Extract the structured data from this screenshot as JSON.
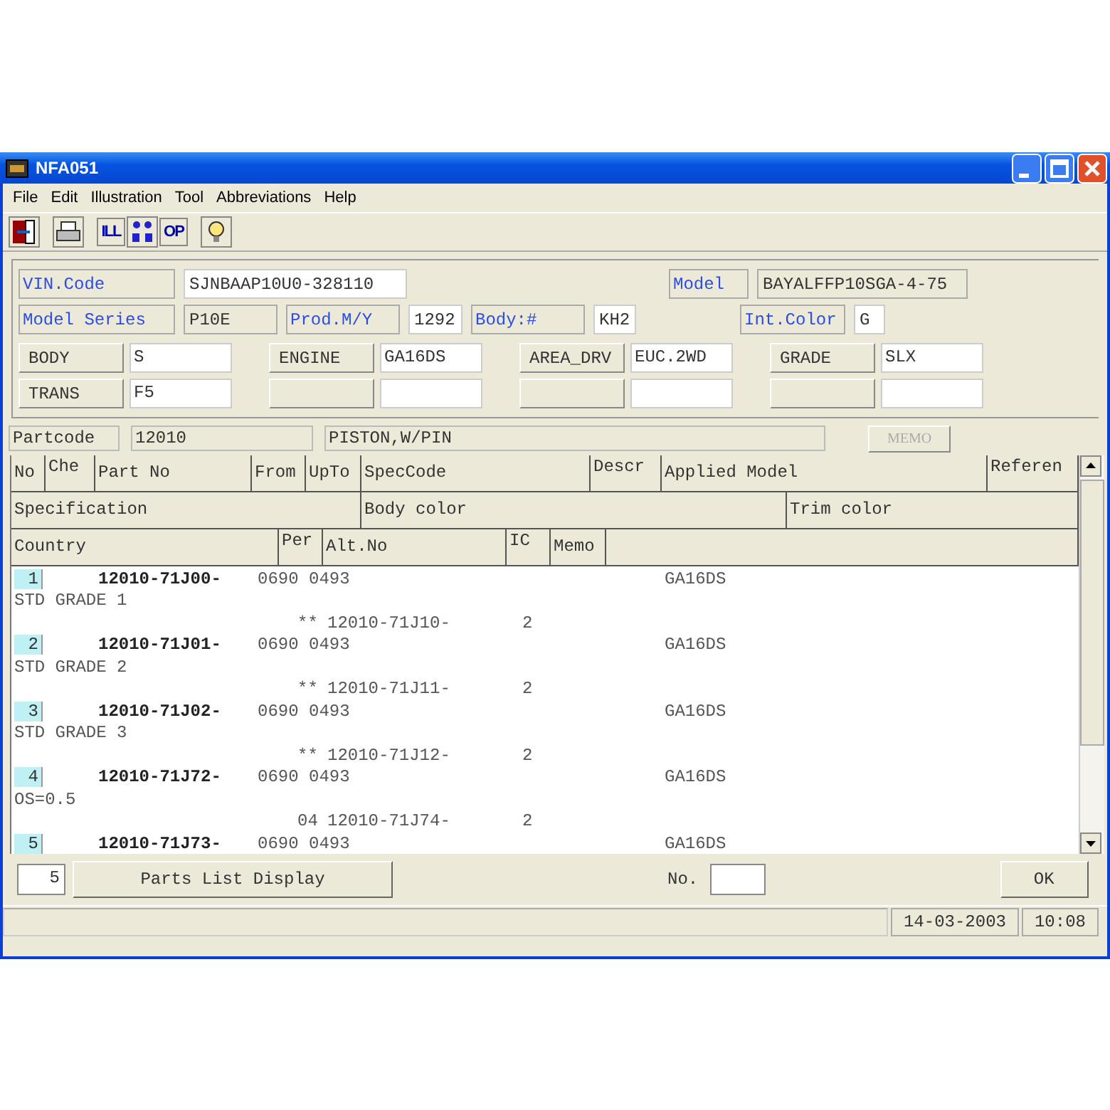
{
  "window": {
    "title": "NFA051"
  },
  "menu": [
    "File",
    "Edit",
    "Illustration",
    "Tool",
    "Abbreviations",
    "Help"
  ],
  "toolbar": [
    {
      "kind": "exit"
    },
    {
      "kind": "print"
    },
    {
      "kind": "text",
      "label": "ILL"
    },
    {
      "kind": "tree"
    },
    {
      "kind": "text",
      "label": "OP"
    },
    {
      "kind": "bulb"
    }
  ],
  "vehicle": {
    "vin_code": {
      "label": "VIN.Code",
      "value": "SJNBAAP10U0-328110"
    },
    "model": {
      "label": "Model",
      "value": "BAYALFFP10SGA-4-75"
    },
    "model_series": {
      "label": "Model Series",
      "value": "P10E"
    },
    "prod_my": {
      "label": "Prod.M/Y",
      "value": "1292"
    },
    "body_no": {
      "label": "Body:#",
      "value": "KH2"
    },
    "int_color": {
      "label": "Int.Color",
      "value": "G"
    }
  },
  "spec_options": [
    {
      "label": "BODY",
      "value": "S"
    },
    {
      "label": "ENGINE",
      "value": "GA16DS"
    },
    {
      "label": "AREA_DRV",
      "value": "EUC.2WD"
    },
    {
      "label": "GRADE",
      "value": "SLX"
    },
    {
      "label": "TRANS",
      "value": "F5"
    }
  ],
  "partcode": {
    "label": "Partcode",
    "value": "12010",
    "description": "PISTON,W/PIN",
    "memo_button": "MEMO"
  },
  "table": {
    "header_row_1": [
      "No",
      "Che",
      "Part No",
      "From",
      "UpTo",
      "SpecCode",
      "Descr",
      "Applied Model",
      "Referen"
    ],
    "header_row_2": [
      "Specification",
      "Body color",
      "Trim color"
    ],
    "header_row_3": [
      "Country",
      "Per",
      "Alt.No",
      "IC",
      "Memo"
    ],
    "rows": [
      {
        "no": "1",
        "part_no": "12010-71J00-",
        "from": "0690",
        "upto": "0493",
        "applied_model": "GA16DS",
        "specification": "STD GRADE 1",
        "alt_prefix": "**",
        "alt_no": "12010-71J10-",
        "ic": "2"
      },
      {
        "no": "2",
        "part_no": "12010-71J01-",
        "from": "0690",
        "upto": "0493",
        "applied_model": "GA16DS",
        "specification": "STD GRADE 2",
        "alt_prefix": "**",
        "alt_no": "12010-71J11-",
        "ic": "2"
      },
      {
        "no": "3",
        "part_no": "12010-71J02-",
        "from": "0690",
        "upto": "0493",
        "applied_model": "GA16DS",
        "specification": "STD GRADE 3",
        "alt_prefix": "**",
        "alt_no": "12010-71J12-",
        "ic": "2"
      },
      {
        "no": "4",
        "part_no": "12010-71J72-",
        "from": "0690",
        "upto": "0493",
        "applied_model": "GA16DS",
        "specification": "OS=0.5",
        "alt_prefix": "04",
        "alt_no": "12010-71J74-",
        "ic": "2"
      },
      {
        "no": "5",
        "part_no": "12010-71J73-",
        "from": "0690",
        "upto": "0493",
        "applied_model": "GA16DS"
      }
    ]
  },
  "footer": {
    "count": "5",
    "parts_list_button": "Parts List Display",
    "no_label": "No.",
    "ok_button": "OK"
  },
  "status_bar": {
    "date": "14-03-2003",
    "time": "10:08"
  }
}
